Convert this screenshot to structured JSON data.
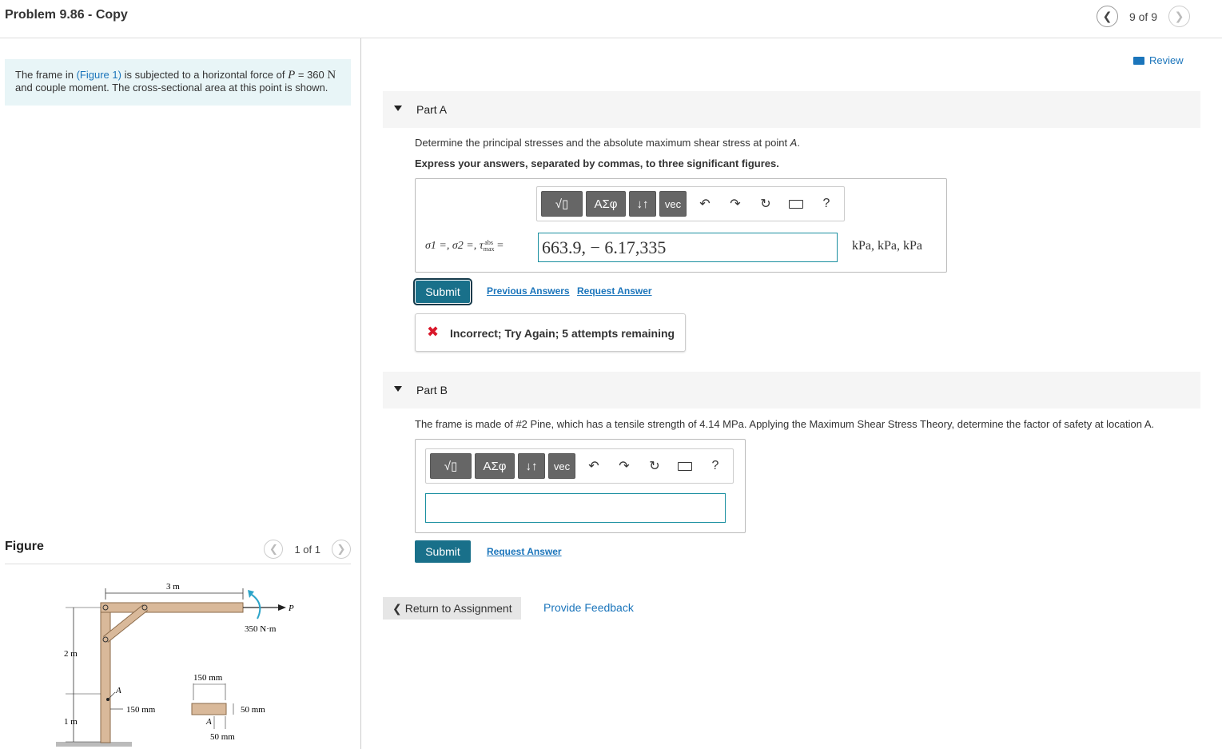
{
  "header": {
    "title": "Problem 9.86 - Copy",
    "pager_text": "9 of 9",
    "prev_icon": "chevron-left-icon",
    "next_icon": "chevron-right-icon"
  },
  "problem": {
    "text_before": "The frame in ",
    "figure_link": "(Figure 1)",
    "text_after": " is subjected to a horizontal force of ",
    "force_var": "P",
    "force_eq": " = 360 ",
    "force_unit": "N",
    "line2": "and couple moment. The cross-sectional area at this point is shown."
  },
  "figure": {
    "title": "Figure",
    "pager_text": "1 of 1",
    "labels": {
      "span": "3 m",
      "P": "P",
      "moment": "350 N·m",
      "h1": "2 m",
      "h2": "1 m",
      "A_frame": "A",
      "dist": "150 mm",
      "sec_width": "150 mm",
      "sec_height": "50 mm",
      "sec_A": "A",
      "sec_offset": "50 mm"
    }
  },
  "review": {
    "label": "Review",
    "icon": "book-icon"
  },
  "partA": {
    "title": "Part A",
    "question": "Determine the principal stresses and the absolute maximum shear stress at point ",
    "question_point": "A",
    "question_end": ".",
    "instruction": "Express your answers, separated by commas, to three significant figures.",
    "toolbar": {
      "templates": "√▯",
      "greek": "ΑΣφ",
      "arrows": "↓↑",
      "vec": "vec",
      "help": "?"
    },
    "label": "σ1 =, σ2 =, τ",
    "label_sup": "abs",
    "label_sub": "max",
    "label_eq": "=",
    "answer": "663.9, − 6.17,335",
    "units": "kPa, kPa, kPa",
    "submit": "Submit",
    "previous_answers": "Previous Answers",
    "request_answer": "Request Answer",
    "feedback": "Incorrect; Try Again; 5 attempts remaining"
  },
  "partB": {
    "title": "Part B",
    "question": "The frame is made of #2 Pine, which has a tensile strength of 4.14 MPa.  Applying the Maximum Shear Stress Theory, determine the factor of safety at location A.",
    "toolbar": {
      "templates": "√▯",
      "greek": "ΑΣφ",
      "arrows": "↓↑",
      "vec": "vec",
      "help": "?"
    },
    "answer": "",
    "submit": "Submit",
    "request_answer": "Request Answer"
  },
  "footer": {
    "return": "Return to Assignment",
    "feedback": "Provide Feedback"
  }
}
